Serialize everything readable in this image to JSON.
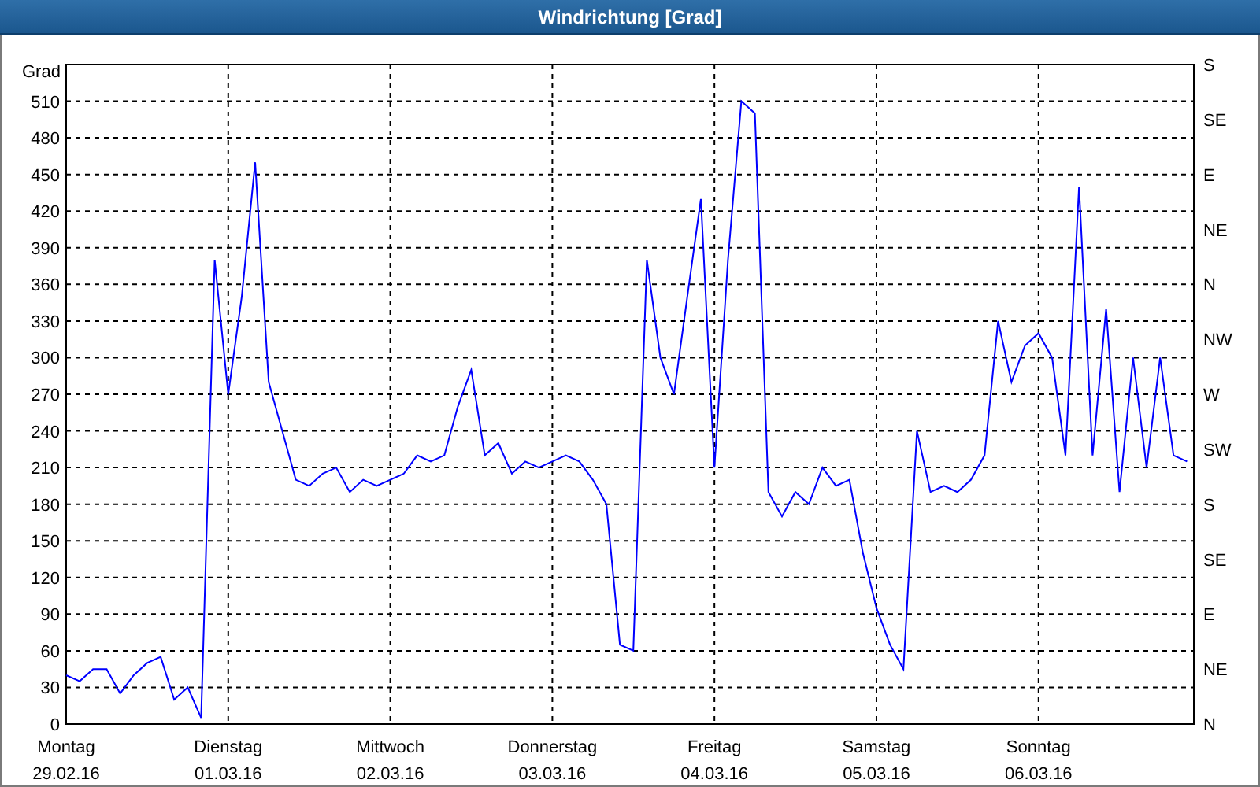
{
  "window": {
    "title": "Windrichtung [Grad]"
  },
  "chart": {
    "chart_data": {
      "type": "line",
      "grid": true,
      "ylabel": "Grad",
      "ylim": [
        0,
        540
      ],
      "yticks": [
        {
          "value": 0,
          "label": "0"
        },
        {
          "value": 30,
          "label": "30"
        },
        {
          "value": 60,
          "label": "60"
        },
        {
          "value": 90,
          "label": "90"
        },
        {
          "value": 120,
          "label": "120"
        },
        {
          "value": 150,
          "label": "150"
        },
        {
          "value": 180,
          "label": "180"
        },
        {
          "value": 210,
          "label": "210"
        },
        {
          "value": 240,
          "label": "240"
        },
        {
          "value": 270,
          "label": "270"
        },
        {
          "value": 300,
          "label": "300"
        },
        {
          "value": 330,
          "label": "330"
        },
        {
          "value": 360,
          "label": "360"
        },
        {
          "value": 390,
          "label": "390"
        },
        {
          "value": 420,
          "label": "420"
        },
        {
          "value": 450,
          "label": "450"
        },
        {
          "value": 480,
          "label": "480"
        },
        {
          "value": 510,
          "label": "510"
        }
      ],
      "categories": [
        "Montag",
        null,
        null,
        null,
        null,
        null,
        null,
        null,
        null,
        null,
        null,
        null,
        "Dienstag",
        null,
        null,
        null,
        null,
        null,
        null,
        null,
        null,
        null,
        null,
        null,
        "Mittwoch",
        null,
        null,
        null,
        null,
        null,
        null,
        null,
        null,
        null,
        null,
        null,
        "Donnerstag",
        null,
        null,
        null,
        null,
        null,
        null,
        null,
        null,
        null,
        null,
        null,
        "Freitag",
        null,
        null,
        null,
        null,
        null,
        null,
        null,
        null,
        null,
        null,
        null,
        "Samstag",
        null,
        null,
        null,
        null,
        null,
        null,
        null,
        null,
        null,
        null,
        null,
        "Sonntag",
        null,
        null,
        null,
        null,
        null,
        null,
        null,
        null,
        null,
        null,
        null
      ],
      "series": [
        {
          "color": "#0000ff",
          "values": [
            40,
            35,
            45,
            45,
            25,
            40,
            50,
            55,
            20,
            30,
            5,
            380,
            270,
            350,
            460,
            280,
            240,
            200,
            195,
            205,
            210,
            190,
            200,
            195,
            200,
            205,
            220,
            215,
            220,
            260,
            290,
            220,
            230,
            205,
            215,
            210,
            215,
            220,
            215,
            200,
            180,
            65,
            60,
            380,
            300,
            270,
            350,
            430,
            210,
            380,
            510,
            500,
            190,
            170,
            190,
            180,
            210,
            195,
            200,
            140,
            95,
            65,
            45,
            240,
            190,
            195,
            190,
            200,
            220,
            330,
            280,
            310,
            320,
            300,
            220,
            440,
            220,
            340,
            190,
            300,
            210,
            300,
            220,
            215
          ]
        }
      ]
    },
    "date_labels": [
      "29.02.16",
      "01.03.16",
      "02.03.16",
      "03.03.16",
      "04.03.16",
      "05.03.16",
      "06.03.16"
    ],
    "right_axis_labels": [
      "S",
      "SE",
      "E",
      "NE",
      "N",
      "NW",
      "W",
      "SW",
      "S",
      "SE",
      "E",
      "NE",
      "N"
    ]
  }
}
